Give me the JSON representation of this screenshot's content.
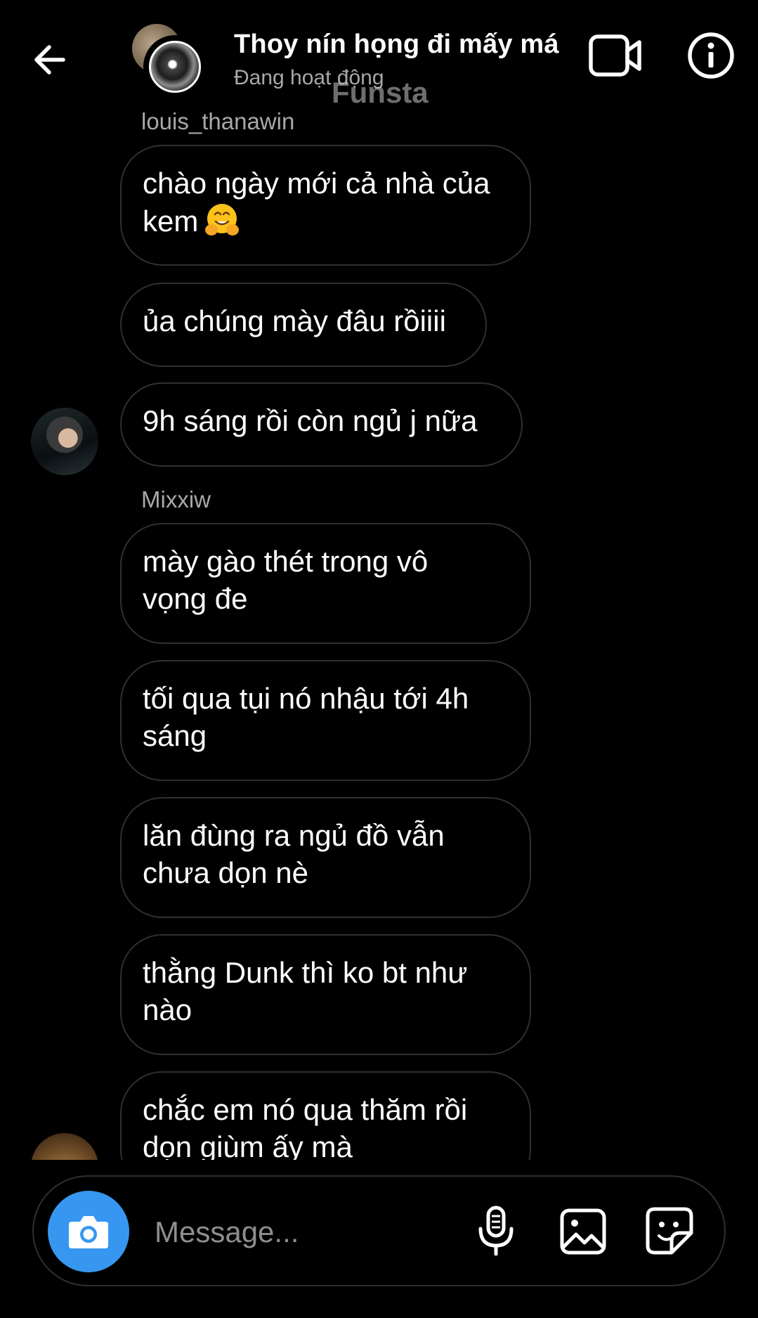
{
  "header": {
    "title": "Thoy nín họng đi mấy má",
    "status": "Đang hoạt động",
    "watermark": "Funsta",
    "icons": [
      "back-arrow-icon",
      "video-call-icon",
      "info-icon"
    ]
  },
  "messages": {
    "group1": {
      "sender": "louis_thanawin",
      "bubbles": [
        {
          "lines": [
            "chào ngày mới cả nhà của",
            "kem"
          ],
          "emoji": "hugging-face"
        },
        {
          "lines": [
            "ủa chúng mày đâu rồiiii"
          ]
        },
        {
          "lines": [
            "9h sáng rồi còn ngủ j nữa"
          ]
        }
      ]
    },
    "group2": {
      "sender": "Mixxiw",
      "bubbles": [
        {
          "lines": [
            "mày gào thét trong vô",
            "vọng đe"
          ]
        },
        {
          "lines": [
            "tối qua tụi nó nhậu tới 4h",
            "sáng"
          ]
        },
        {
          "lines": [
            "lăn đùng ra ngủ đồ vẫn",
            "chưa dọn nè"
          ]
        },
        {
          "lines": [
            "thằng Dunk thì ko bt như",
            "nào"
          ]
        },
        {
          "lines": [
            "chắc em nó qua thăm rồi",
            "dọn giùm ấy mà"
          ]
        }
      ]
    }
  },
  "composer": {
    "placeholder": "Message...",
    "camera_color": "#3797f0",
    "icons": [
      "camera-icon",
      "microphone-icon",
      "gallery-icon",
      "sticker-icon"
    ]
  },
  "colors": {
    "background": "#000000",
    "bubble_border": "#2f2f2f",
    "secondary_text": "#a8a8a8",
    "accent": "#3797f0"
  }
}
